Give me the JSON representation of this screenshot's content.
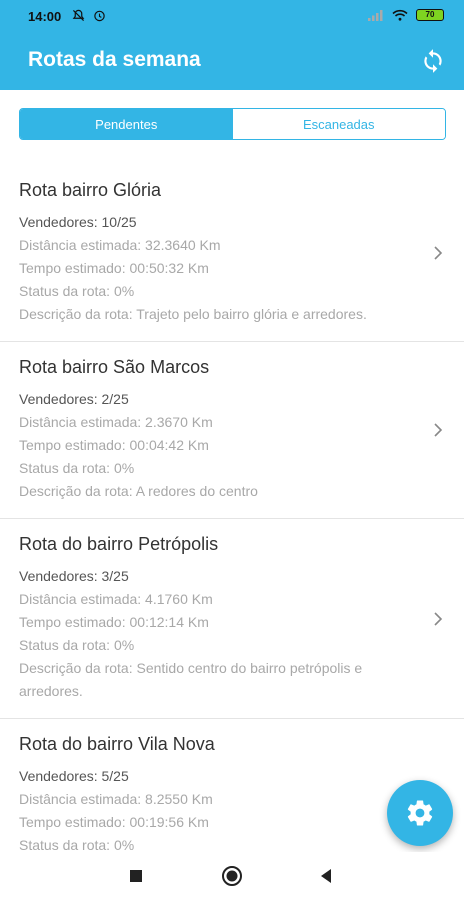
{
  "status_bar": {
    "time": "14:00",
    "icons": [
      "mute-icon",
      "alarm-icon",
      "signal-icon",
      "wifi-icon"
    ],
    "battery": "70"
  },
  "app_bar": {
    "title": "Rotas da semana",
    "action_icon": "sync-icon"
  },
  "tabs": [
    {
      "label": "Pendentes",
      "active": true
    },
    {
      "label": "Escaneadas",
      "active": false
    }
  ],
  "routes": [
    {
      "name": "Rota bairro Glória",
      "vendedores": "Vendedores: 10/25",
      "distancia": "Distância estimada: 32.3640 Km",
      "tempo": "Tempo estimado: 00:50:32 Km",
      "status": "Status da rota: 0%",
      "descricao": "Descrição da rota: Trajeto pelo bairro glória e arredores."
    },
    {
      "name": "Rota bairro São Marcos",
      "vendedores": "Vendedores: 2/25",
      "distancia": "Distância estimada: 2.3670 Km",
      "tempo": "Tempo estimado: 00:04:42 Km",
      "status": "Status da rota: 0%",
      "descricao": "Descrição da rota: A redores do centro"
    },
    {
      "name": "Rota do bairro Petrópolis",
      "vendedores": "Vendedores: 3/25",
      "distancia": "Distância estimada: 4.1760 Km",
      "tempo": "Tempo estimado: 00:12:14 Km",
      "status": "Status da rota: 0%",
      "descricao": "Descrição da rota: Sentido centro do bairro petrópolis e arredores."
    },
    {
      "name": "Rota do bairro Vila Nova",
      "vendedores": "Vendedores: 5/25",
      "distancia": "Distância estimada: 8.2550 Km",
      "tempo": "Tempo estimado: 00:19:56 Km",
      "status": "Status da rota: 0%",
      "descricao": ""
    }
  ],
  "fab": {
    "icon": "gear-icon"
  },
  "nav_bar": {
    "icons": [
      "recents-icon",
      "home-icon",
      "back-icon"
    ]
  },
  "colors": {
    "primary": "#33b5e5",
    "text_dark": "#333333",
    "text_muted": "#a8a8a8"
  }
}
